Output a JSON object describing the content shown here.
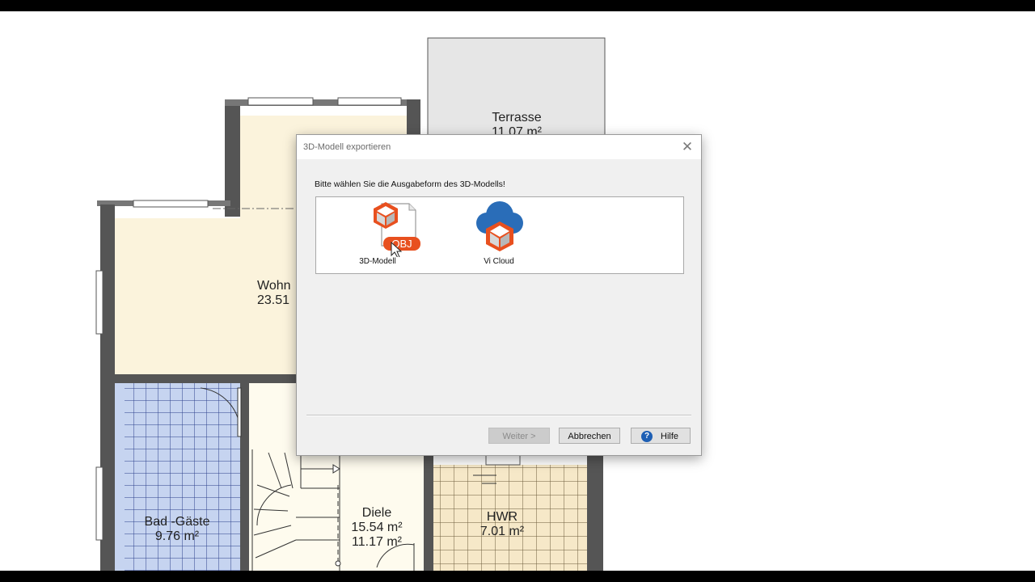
{
  "floorplan": {
    "rooms": [
      {
        "name": "Terrasse",
        "area": "11.07 m²"
      },
      {
        "name": "Wohn",
        "area": "23.51"
      },
      {
        "name": "Bad -Gäste",
        "area": "9.76 m²"
      },
      {
        "name": "Diele",
        "area": "15.54 m²",
        "area2": "11.17 m²"
      },
      {
        "name": "HWR",
        "area": "7.01 m²"
      }
    ]
  },
  "dialog": {
    "title": "3D-Modell exportieren",
    "close_glyph": "✕",
    "prompt": "Bitte wählen Sie die Ausgabeform des 3D-Modells!",
    "options": [
      {
        "label": "3D-Modell",
        "badge": "OBJ",
        "icon": "obj-file-icon"
      },
      {
        "label": "Vi Cloud",
        "icon": "cloud-icon"
      }
    ],
    "buttons": {
      "next": "Weiter >",
      "cancel": "Abbrechen",
      "help": "Hilfe",
      "help_glyph": "?"
    }
  },
  "colors": {
    "accent_orange": "#e8501f",
    "cloud_blue": "#2a6db8",
    "bath_tile_blue": "#c6d4f0",
    "hwr_tile_beige": "#f6e8c8",
    "living_room_fill": "#fbf3dc"
  }
}
